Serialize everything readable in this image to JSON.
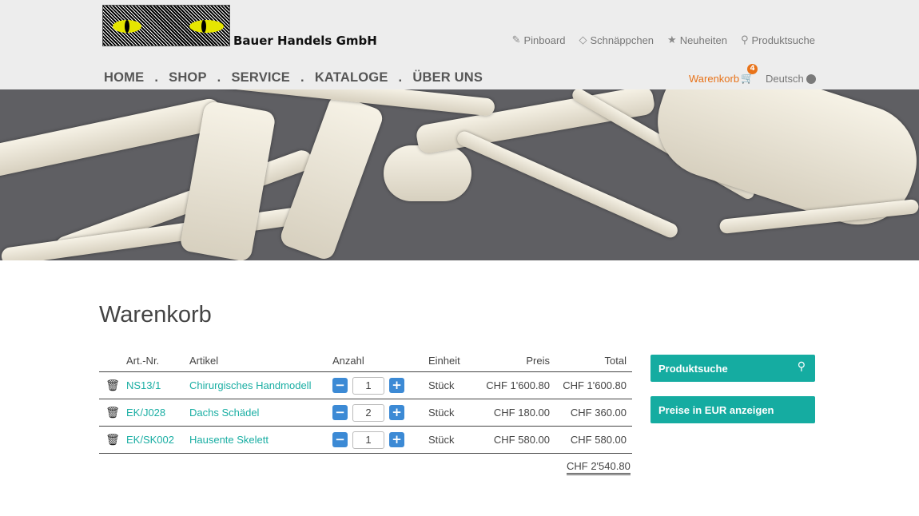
{
  "header": {
    "company_name": "Bauer Handels GmbH",
    "top_links": [
      {
        "label": "Pinboard",
        "icon": "pin-icon"
      },
      {
        "label": "Schnäppchen",
        "icon": "diamond-icon"
      },
      {
        "label": "Neuheiten",
        "icon": "star-icon"
      },
      {
        "label": "Produktsuche",
        "icon": "search-icon"
      }
    ],
    "main_nav": [
      "HOME",
      "SHOP",
      "SERVICE",
      "KATALOGE",
      "ÜBER UNS"
    ],
    "nav_separator": ".",
    "cart_label": "Warenkorb",
    "cart_count": "4",
    "language": "Deutsch"
  },
  "page": {
    "title": "Warenkorb"
  },
  "cart": {
    "columns": [
      "Art.-Nr.",
      "Artikel",
      "Anzahl",
      "Einheit",
      "Preis",
      "Total"
    ],
    "rows": [
      {
        "nr": "NS13/1",
        "article": "Chirurgisches Handmodell",
        "qty": "1",
        "unit": "Stück",
        "price": "CHF 1'600.80",
        "total": "CHF 1'600.80"
      },
      {
        "nr": "EK/J028",
        "article": "Dachs Schädel",
        "qty": "2",
        "unit": "Stück",
        "price": "CHF 180.00",
        "total": "CHF 360.00"
      },
      {
        "nr": "EK/SK002",
        "article": "Hausente Skelett",
        "qty": "1",
        "unit": "Stück",
        "price": "CHF 580.00",
        "total": "CHF 580.00"
      }
    ],
    "grand_total": "CHF 2'540.80",
    "minus": "−",
    "plus": "+"
  },
  "sidebar": {
    "search_button": "Produktsuche",
    "eur_button": "Preise in EUR anzeigen"
  },
  "colors": {
    "accent_teal": "#15aca1",
    "cart_orange": "#e8731a",
    "qty_blue": "#3c8ad5"
  }
}
